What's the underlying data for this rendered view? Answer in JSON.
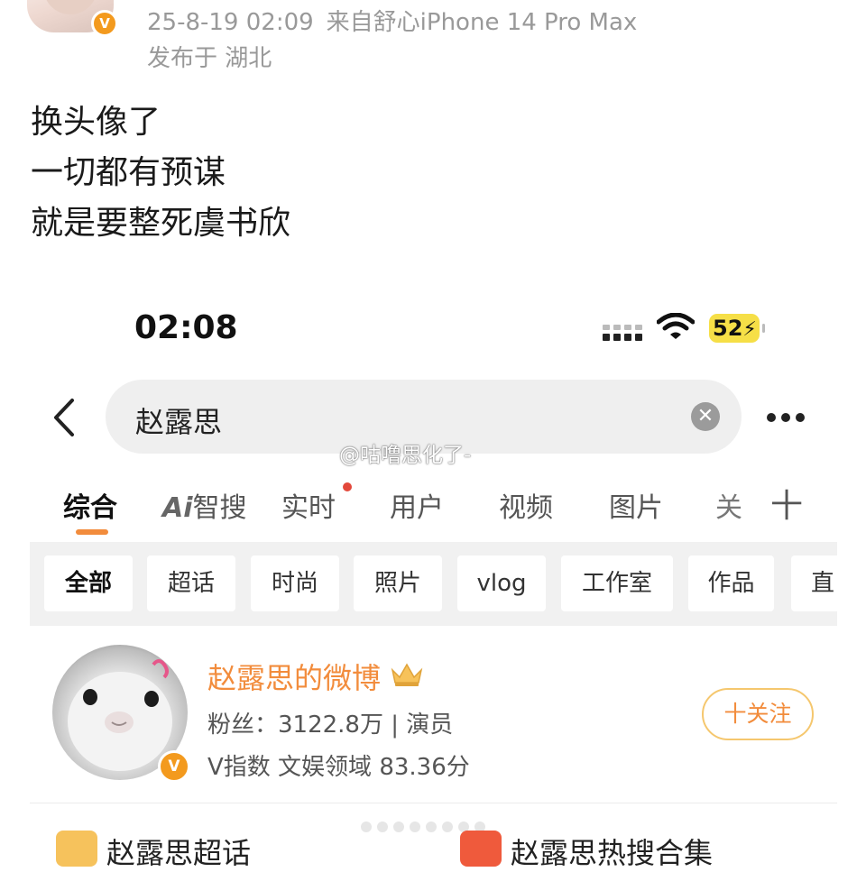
{
  "post": {
    "meta_time": "25-8-19 02:09",
    "meta_device": "来自舒心iPhone 14 Pro Max",
    "location": "发布于 湖北",
    "lines": [
      "换头像了",
      "一切都有预谋",
      "就是要整死虞书欣"
    ],
    "verified_badge": "V"
  },
  "phone": {
    "status_time": "02:08",
    "battery": "52"
  },
  "search": {
    "query": "赵露思",
    "clear_symbol": "✕"
  },
  "watermark": "@咕噜思化了-",
  "tabs": [
    {
      "label": "综合",
      "active": true
    },
    {
      "label_prefix": "Ai",
      "label": "智搜"
    },
    {
      "label": "实时",
      "has_dot": true
    },
    {
      "label": "用户"
    },
    {
      "label": "视频"
    },
    {
      "label": "图片"
    },
    {
      "label": "关"
    }
  ],
  "plus_symbol": "十",
  "chips": [
    "全部",
    "超话",
    "时尚",
    "照片",
    "vlog",
    "工作室",
    "作品",
    "直"
  ],
  "user_card": {
    "name": "赵露思的微博",
    "fans": "粉丝：3122.8万 | 演员",
    "index": "V指数 文娱领域 83.36分",
    "follow_label": "十关注",
    "verified_badge": "V"
  },
  "bottom": {
    "chaohua_label": "赵露思超话",
    "hot_label": "赵露思热搜合集"
  },
  "colors": {
    "accent": "#f28c3c",
    "badge": "#f39a1e",
    "battery": "#f6df47"
  }
}
